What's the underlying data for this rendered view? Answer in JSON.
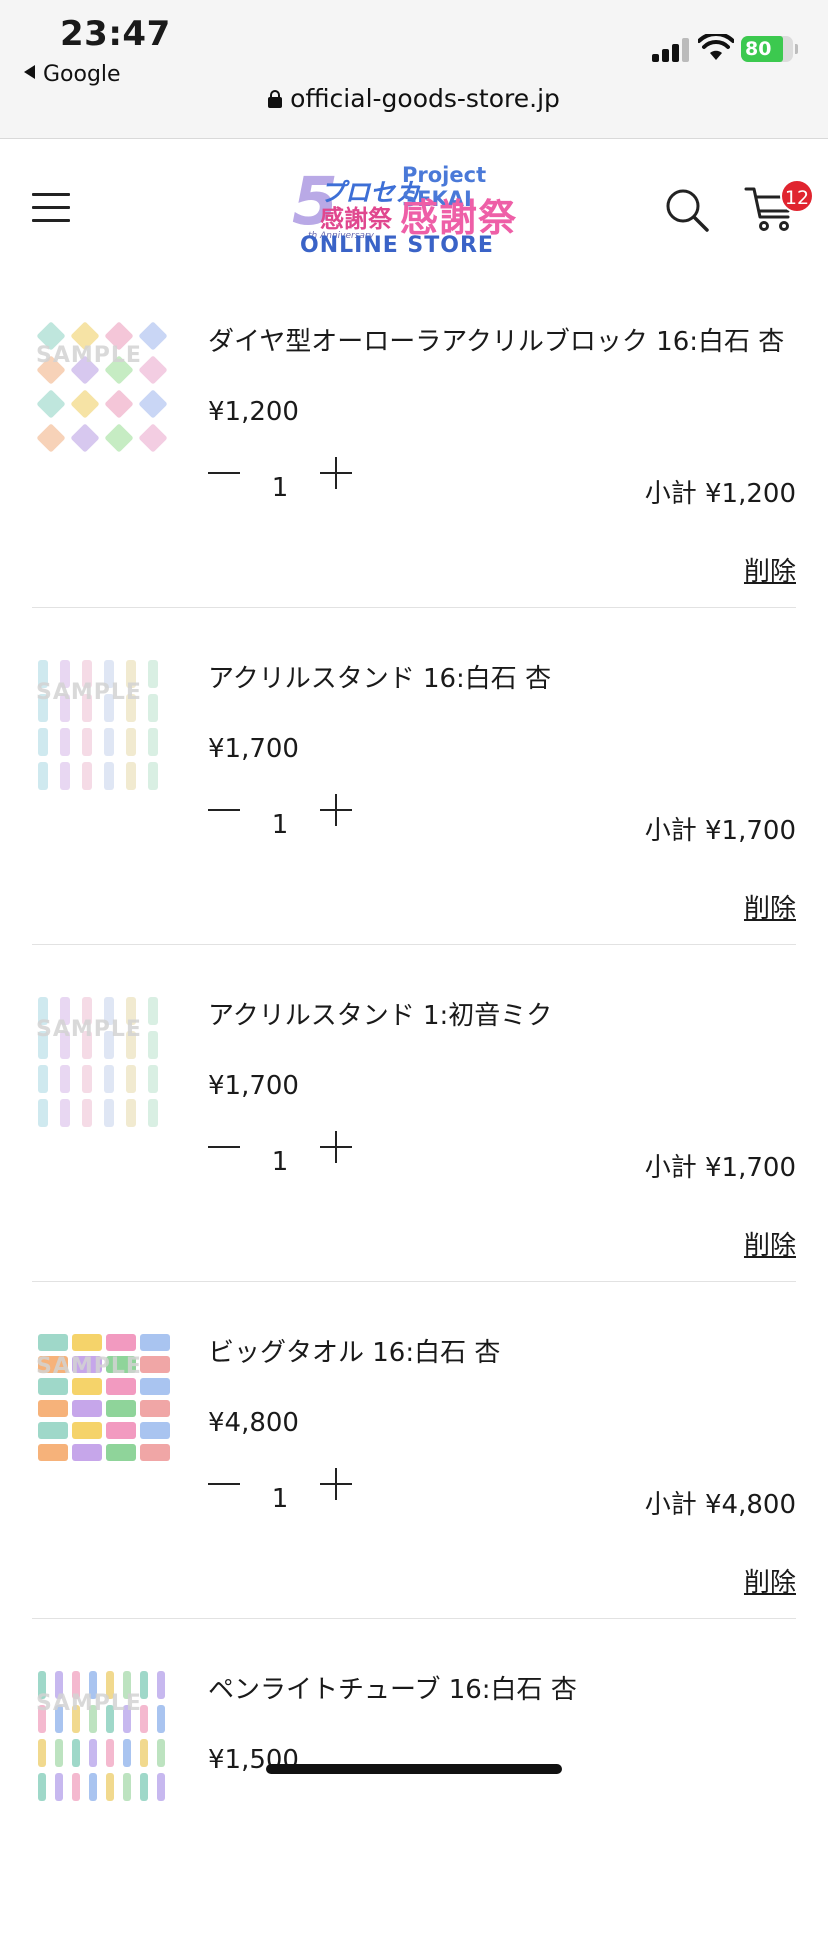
{
  "status_bar": {
    "time": "23:47",
    "back_app": "Google",
    "battery": "80",
    "url": "official-goods-store.jp"
  },
  "header": {
    "menu_icon": "hamburger-menu-icon",
    "logo": {
      "line1": "5",
      "line2": "プロセカ",
      "line3": "感謝祭",
      "anniversary": "th Anniversary",
      "project": "Project SEKAI",
      "title": "感謝祭",
      "store": "ONLINE STORE"
    },
    "search_icon": "search-icon",
    "cart_icon": "cart-icon",
    "cart_count": "12"
  },
  "cart": {
    "qty_minus": "−",
    "qty_plus": "+",
    "subtotal_prefix": "小計",
    "remove_label": "削除",
    "items": [
      {
        "name": "ダイヤ型オーローラアクリルブロック 16:白石 杏",
        "price": "¥1,200",
        "qty": "1",
        "subtotal": "¥1,200",
        "thumb_watermark": "SAMPLE"
      },
      {
        "name": "アクリルスタンド 16:白石 杏",
        "price": "¥1,700",
        "qty": "1",
        "subtotal": "¥1,700",
        "thumb_watermark": "SAMPLE"
      },
      {
        "name": "アクリルスタンド 1:初音ミク",
        "price": "¥1,700",
        "qty": "1",
        "subtotal": "¥1,700",
        "thumb_watermark": "SAMPLE"
      },
      {
        "name": "ビッグタオル 16:白石 杏",
        "price": "¥4,800",
        "qty": "1",
        "subtotal": "¥4,800",
        "thumb_watermark": "SAMPLE"
      },
      {
        "name": "ペンライトチューブ 16:白石 杏",
        "price": "¥1,500",
        "qty": "",
        "subtotal": "",
        "thumb_watermark": "SAMPLE"
      }
    ]
  }
}
